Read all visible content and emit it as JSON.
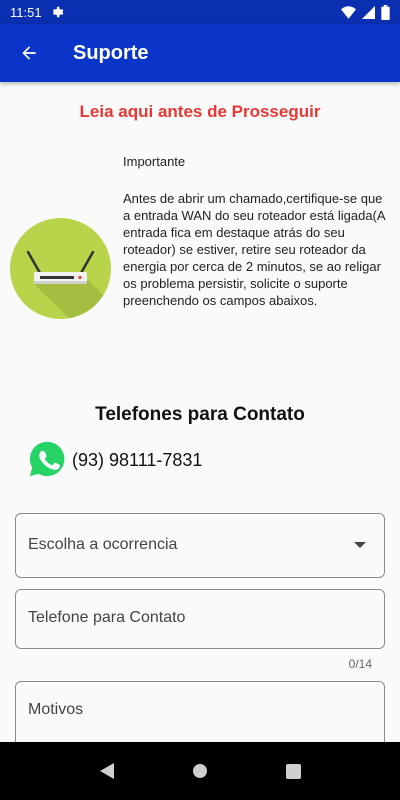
{
  "status_bar": {
    "time": "11:51"
  },
  "app_bar": {
    "title": "Suporte"
  },
  "warning": {
    "title": "Leia aqui antes de Prosseguir"
  },
  "info": {
    "heading": "Importante",
    "body": "Antes de abrir um chamado,certifique-se que a entrada WAN do seu roteador está ligada(A entrada fica em destaque atrás do seu roteador) se estiver, retire seu roteador da energia por cerca de 2 minutos, se ao religar os problema persistir, solicite o suporte preenchendo os campos abaixos."
  },
  "contacts": {
    "title": "Telefones para Contato",
    "phone": "(93) 98111-7831"
  },
  "form": {
    "occurrence_label": "Escolha a ocorrencia",
    "phone_label": "Telefone para Contato",
    "phone_counter": "0/14",
    "reasons_label": "Motivos"
  },
  "colors": {
    "app_bar": "#0a35c8",
    "warning_text": "#e53935",
    "router_bg": "#b7d44a",
    "whatsapp": "#25d366"
  },
  "icons": [
    "gear-icon",
    "wifi-icon",
    "signal-icon",
    "battery-icon",
    "back-arrow-icon",
    "router-icon",
    "whatsapp-icon",
    "dropdown-arrow-icon",
    "nav-back-icon",
    "nav-home-icon",
    "nav-recents-icon"
  ]
}
